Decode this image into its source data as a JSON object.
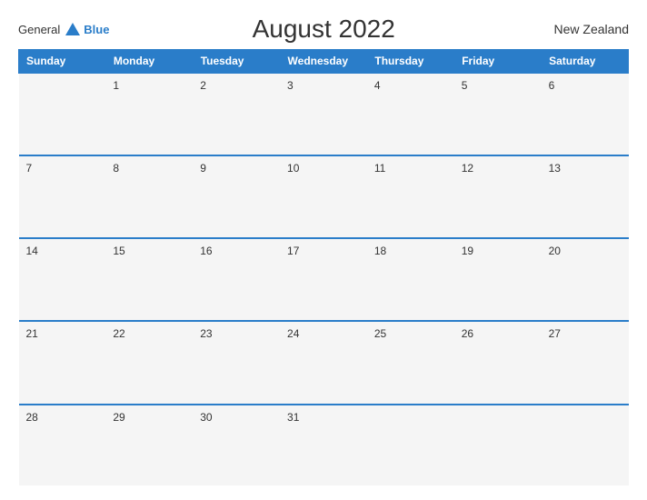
{
  "header": {
    "logo_general": "General",
    "logo_blue": "Blue",
    "title": "August 2022",
    "region": "New Zealand"
  },
  "weekdays": [
    "Sunday",
    "Monday",
    "Tuesday",
    "Wednesday",
    "Thursday",
    "Friday",
    "Saturday"
  ],
  "weeks": [
    [
      "",
      "1",
      "2",
      "3",
      "4",
      "5",
      "6"
    ],
    [
      "7",
      "8",
      "9",
      "10",
      "11",
      "12",
      "13"
    ],
    [
      "14",
      "15",
      "16",
      "17",
      "18",
      "19",
      "20"
    ],
    [
      "21",
      "22",
      "23",
      "24",
      "25",
      "26",
      "27"
    ],
    [
      "28",
      "29",
      "30",
      "31",
      "",
      "",
      ""
    ]
  ]
}
